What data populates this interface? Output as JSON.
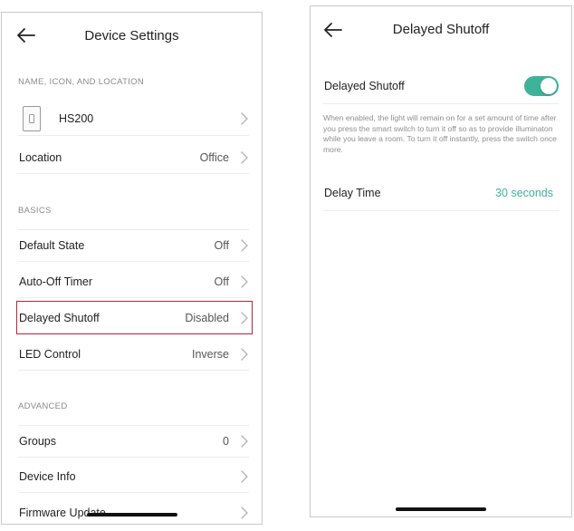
{
  "colors": {
    "accent": "#3fb39a",
    "highlight": "#b3263a",
    "divider": "#ececec",
    "section_label": "#8a8a8a"
  },
  "left_screen": {
    "title": "Device Settings",
    "sections": {
      "name_icon_location": {
        "label": "NAME, ICON, AND LOCATION",
        "device_name": "HS200",
        "device_icon": "light-switch-icon",
        "location_label": "Location",
        "location_value": "Office"
      },
      "basics": {
        "label": "BASICS",
        "rows": [
          {
            "label": "Default State",
            "value": "Off"
          },
          {
            "label": "Auto-Off Timer",
            "value": "Off"
          },
          {
            "label": "Delayed Shutoff",
            "value": "Disabled"
          },
          {
            "label": "LED Control",
            "value": "Inverse"
          }
        ]
      },
      "advanced": {
        "label": "ADVANCED",
        "rows": [
          {
            "label": "Groups",
            "value": "0"
          },
          {
            "label": "Device Info",
            "value": ""
          },
          {
            "label": "Firmware Update",
            "value": ""
          }
        ]
      }
    }
  },
  "right_screen": {
    "title": "Delayed Shutoff",
    "toggle_label": "Delayed Shutoff",
    "toggle_state": "on",
    "description": "When enabled, the light will remain on for a set amount of time after you press the smart switch to turn it off so as to provide illuminaton while you leave a room. To turn it off instantly, press the switch once more.",
    "delay_label": "Delay Time",
    "delay_value": "30 seconds"
  }
}
